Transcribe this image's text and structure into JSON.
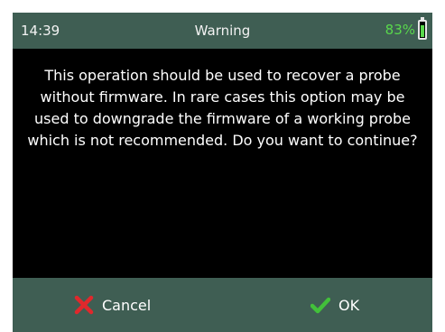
{
  "status": {
    "time": "14:39",
    "title": "Warning",
    "battery_label": "83%",
    "battery_level": 0.83,
    "battery_icon": "battery-icon"
  },
  "dialog": {
    "message": "This operation should be used to recover a probe without firmware. In rare cases this option may be used to downgrade the firmware of a working probe which is not recommended. Do you want to continue?"
  },
  "actions": {
    "cancel_label": "Cancel",
    "cancel_icon": "x-icon",
    "ok_label": "OK",
    "ok_icon": "checkmark-icon"
  },
  "colors": {
    "bar_background": "#3f5e53",
    "screen_background": "#000000",
    "text": "#ffffff",
    "battery_green": "#59d84c",
    "cancel_red": "#e0282c",
    "ok_green": "#42c03a"
  }
}
